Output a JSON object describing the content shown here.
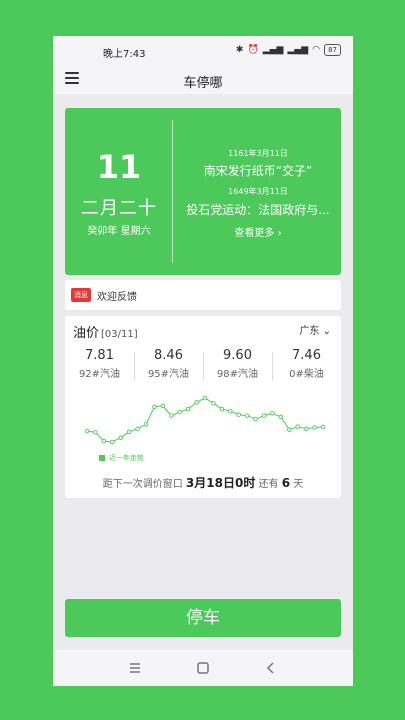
{
  "status": {
    "time": "晚上7:43",
    "battery": "87"
  },
  "app": {
    "title": "车停哪"
  },
  "date_card": {
    "day": "11",
    "lunar": "二月二十",
    "weekday": "癸卯年 星期六",
    "events": [
      {
        "date": "1161年3月11日",
        "title": "南宋发行纸币“交子”"
      },
      {
        "date": "1649年3月11日",
        "title": "投石党运动：法国政府与..."
      }
    ],
    "see_more": "查看更多 ›"
  },
  "notice": {
    "badge": "消息",
    "text": "欢迎反馈"
  },
  "oil": {
    "title": "油价",
    "date": "[03/11]",
    "region": "广东 ⌄",
    "prices": [
      {
        "value": "7.81",
        "label": "92#汽油"
      },
      {
        "value": "8.46",
        "label": "95#汽油"
      },
      {
        "value": "9.60",
        "label": "98#汽油"
      },
      {
        "value": "7.46",
        "label": "0#柴油"
      }
    ],
    "legend": "近一年走势",
    "adjust_prefix": "距下一次调价窗口",
    "adjust_date": "3月18日0时",
    "adjust_mid": "还有",
    "adjust_days": "6",
    "adjust_suffix": "天"
  },
  "park_button": "停车",
  "colors": {
    "brand": "#4cc95a",
    "badge": "#e53935"
  },
  "icons": {
    "menu": "menu-icon",
    "recent": "recent-apps-icon",
    "home": "home-icon",
    "back": "back-icon"
  },
  "chart_data": {
    "type": "line",
    "title": "",
    "series": [
      {
        "name": "近一年走势",
        "values": [
          7.35,
          7.32,
          7.12,
          7.1,
          7.2,
          7.33,
          7.4,
          7.5,
          7.9,
          7.92,
          7.7,
          7.78,
          7.85,
          8.0,
          8.1,
          7.98,
          7.85,
          7.8,
          7.72,
          7.7,
          7.62,
          7.7,
          7.75,
          7.67,
          7.38,
          7.45,
          7.4,
          7.43,
          7.44
        ]
      }
    ],
    "grid": false
  }
}
